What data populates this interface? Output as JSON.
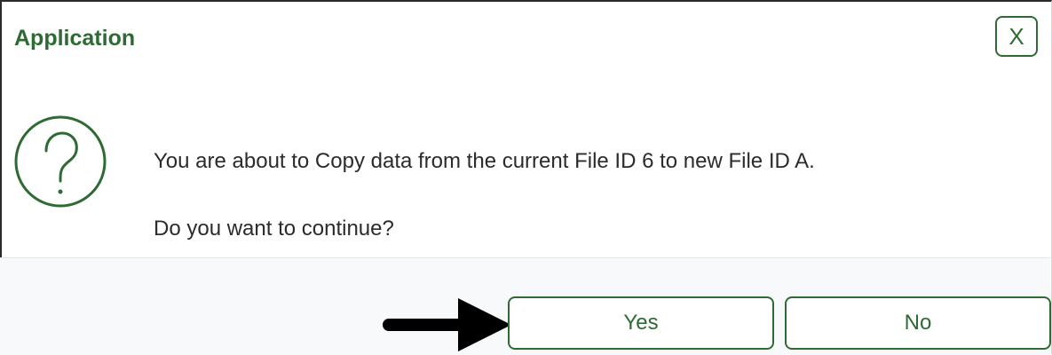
{
  "dialog": {
    "title": "Application",
    "close_label": "X",
    "icon": "question-circle-icon",
    "message": "You are about to Copy data from the current File ID 6 to new File ID A.",
    "question": "Do you want to continue?",
    "buttons": {
      "yes_label": "Yes",
      "no_label": "No"
    },
    "annotation_icon": "arrow-right-icon"
  },
  "colors": {
    "accent": "#2e6b33",
    "text": "#2b2b2b",
    "footer_bg": "#f8f9fa"
  }
}
